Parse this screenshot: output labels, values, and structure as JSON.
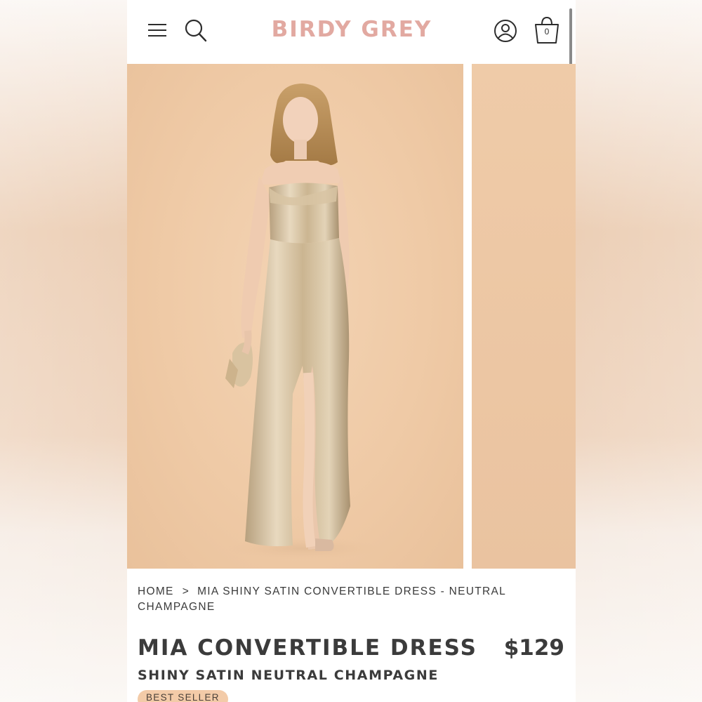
{
  "header": {
    "logo": "BIRDY GREY",
    "cart_count": "0",
    "icons": {
      "menu": "hamburger-menu-icon",
      "search": "search-icon",
      "account": "account-icon",
      "bag": "shopping-bag-icon"
    }
  },
  "breadcrumb": {
    "home": "HOME",
    "separator": ">",
    "current": "MIA SHINY SATIN CONVERTIBLE DRESS - NEUTRAL CHAMPAGNE"
  },
  "product": {
    "title": "MIA CONVERTIBLE DRESS",
    "price": "$129",
    "subtitle": "SHINY SATIN NEUTRAL CHAMPAGNE",
    "badge": "BEST SELLER"
  },
  "colors": {
    "logo": "#e2a9a1",
    "backdrop": "#efcaa6",
    "badge": "#f3cba8",
    "text": "#3b3b3b"
  }
}
